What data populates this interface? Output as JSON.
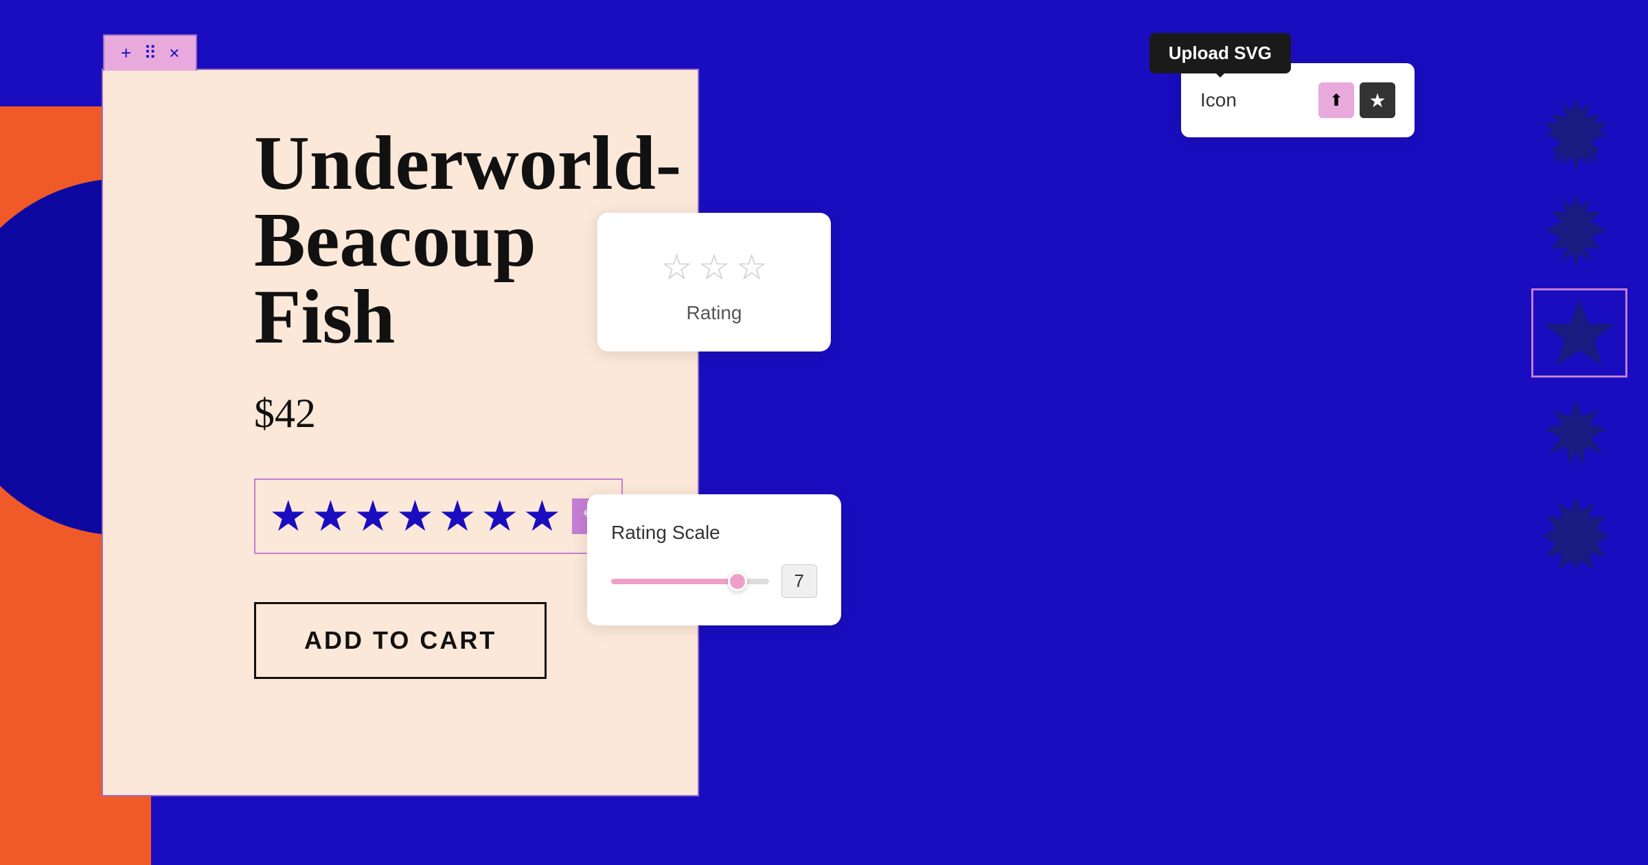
{
  "page": {
    "background_color": "#1a0dbf"
  },
  "tab": {
    "icons": [
      "＋",
      "⠿",
      "×"
    ]
  },
  "product": {
    "title": "Underworld-Beacoup Fish",
    "price": "$42",
    "stars_count": 7,
    "add_to_cart_label": "ADD TO CART"
  },
  "rating_widget": {
    "stars_count": 3,
    "label": "Rating"
  },
  "rating_scale_widget": {
    "title": "Rating Scale",
    "value": "7",
    "slider_percent": 75
  },
  "icon_panel": {
    "label": "Icon",
    "upload_icon": "⬆",
    "star_icon": "★",
    "tooltip": "Upload SVG"
  },
  "star_column": {
    "shapes": [
      "burst8",
      "burst8",
      "star6_selected",
      "burst6",
      "burst7"
    ]
  }
}
